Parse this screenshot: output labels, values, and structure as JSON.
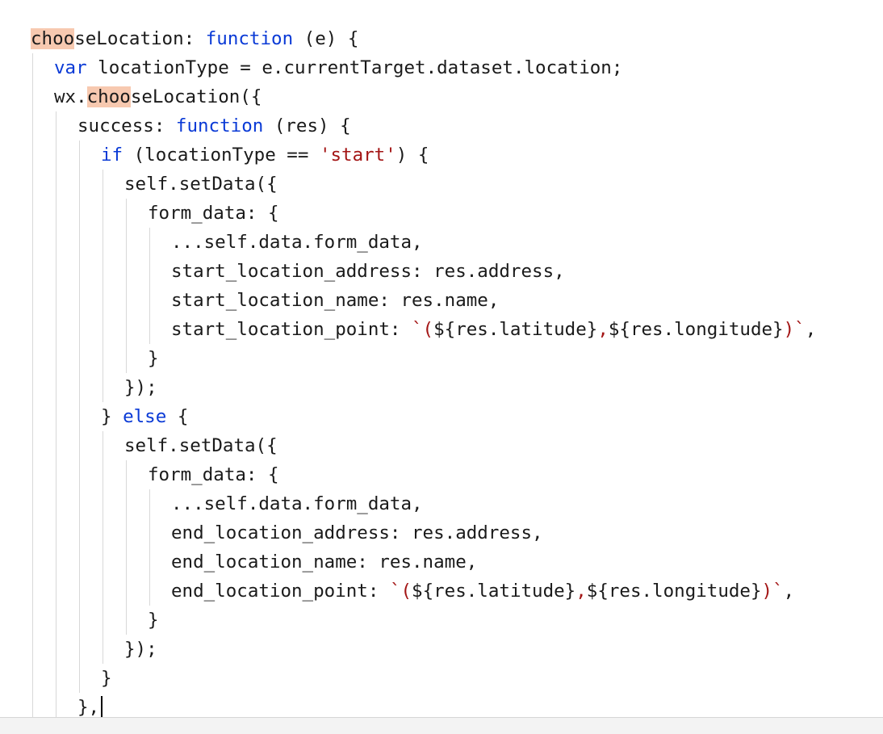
{
  "editor": {
    "highlight_term": "choo",
    "lines": [
      {
        "indent": 0,
        "tokens": [
          {
            "t": "choo",
            "c": "hl"
          },
          {
            "t": "seLocation: ",
            "c": "plain"
          },
          {
            "t": "function",
            "c": "kw"
          },
          {
            "t": " (e) {",
            "c": "plain"
          }
        ]
      },
      {
        "indent": 1,
        "tokens": [
          {
            "t": "var",
            "c": "kw"
          },
          {
            "t": " locationType = e.currentTarget.dataset.location;",
            "c": "plain"
          }
        ]
      },
      {
        "indent": 1,
        "tokens": [
          {
            "t": "wx.",
            "c": "plain"
          },
          {
            "t": "choo",
            "c": "hl"
          },
          {
            "t": "seLocation({",
            "c": "plain"
          }
        ]
      },
      {
        "indent": 2,
        "tokens": [
          {
            "t": "success: ",
            "c": "plain"
          },
          {
            "t": "function",
            "c": "kw"
          },
          {
            "t": " (res) {",
            "c": "plain"
          }
        ]
      },
      {
        "indent": 3,
        "tokens": [
          {
            "t": "if",
            "c": "kw"
          },
          {
            "t": " (locationType == ",
            "c": "plain"
          },
          {
            "t": "'start'",
            "c": "str"
          },
          {
            "t": ") {",
            "c": "plain"
          }
        ]
      },
      {
        "indent": 4,
        "tokens": [
          {
            "t": "self.setData({",
            "c": "plain"
          }
        ]
      },
      {
        "indent": 5,
        "tokens": [
          {
            "t": "form_data: {",
            "c": "plain"
          }
        ]
      },
      {
        "indent": 6,
        "tokens": [
          {
            "t": "...self.data.form_data,",
            "c": "plain"
          }
        ]
      },
      {
        "indent": 6,
        "tokens": [
          {
            "t": "start_location_address: res.address,",
            "c": "plain"
          }
        ]
      },
      {
        "indent": 6,
        "tokens": [
          {
            "t": "start_location_name: res.name,",
            "c": "plain"
          }
        ]
      },
      {
        "indent": 6,
        "tokens": [
          {
            "t": "start_location_point: ",
            "c": "plain"
          },
          {
            "t": "`(",
            "c": "tpl"
          },
          {
            "t": "${res.latitude}",
            "c": "plain"
          },
          {
            "t": ",",
            "c": "tpl"
          },
          {
            "t": "${res.longitude}",
            "c": "plain"
          },
          {
            "t": ")`",
            "c": "tpl"
          },
          {
            "t": ",",
            "c": "plain"
          }
        ]
      },
      {
        "indent": 5,
        "tokens": [
          {
            "t": "}",
            "c": "plain"
          }
        ]
      },
      {
        "indent": 4,
        "tokens": [
          {
            "t": "});",
            "c": "plain"
          }
        ]
      },
      {
        "indent": 3,
        "tokens": [
          {
            "t": "} ",
            "c": "plain"
          },
          {
            "t": "else",
            "c": "kw"
          },
          {
            "t": " {",
            "c": "plain"
          }
        ]
      },
      {
        "indent": 4,
        "tokens": [
          {
            "t": "self.setData({",
            "c": "plain"
          }
        ]
      },
      {
        "indent": 5,
        "tokens": [
          {
            "t": "form_data: {",
            "c": "plain"
          }
        ]
      },
      {
        "indent": 6,
        "tokens": [
          {
            "t": "...self.data.form_data,",
            "c": "plain"
          }
        ]
      },
      {
        "indent": 6,
        "tokens": [
          {
            "t": "end_location_address: res.address,",
            "c": "plain"
          }
        ]
      },
      {
        "indent": 6,
        "tokens": [
          {
            "t": "end_location_name: res.name,",
            "c": "plain"
          }
        ]
      },
      {
        "indent": 6,
        "tokens": [
          {
            "t": "end_location_point: ",
            "c": "plain"
          },
          {
            "t": "`(",
            "c": "tpl"
          },
          {
            "t": "${res.latitude}",
            "c": "plain"
          },
          {
            "t": ",",
            "c": "tpl"
          },
          {
            "t": "${res.longitude}",
            "c": "plain"
          },
          {
            "t": ")`",
            "c": "tpl"
          },
          {
            "t": ",",
            "c": "plain"
          }
        ]
      },
      {
        "indent": 5,
        "tokens": [
          {
            "t": "}",
            "c": "plain"
          }
        ]
      },
      {
        "indent": 4,
        "tokens": [
          {
            "t": "});",
            "c": "plain"
          }
        ]
      },
      {
        "indent": 3,
        "tokens": [
          {
            "t": "}",
            "c": "plain"
          }
        ]
      },
      {
        "indent": 2,
        "tokens": [
          {
            "t": "},",
            "c": "plain"
          }
        ]
      }
    ],
    "cursor_line": 23
  },
  "statusbar": {
    "left_text": "",
    "right_text": ""
  },
  "colors": {
    "keyword": "#0a3ad6",
    "string": "#a31515",
    "highlight": "#f7c9b0",
    "indent_guide": "#d8d8d8",
    "text": "#1a1a1a"
  }
}
